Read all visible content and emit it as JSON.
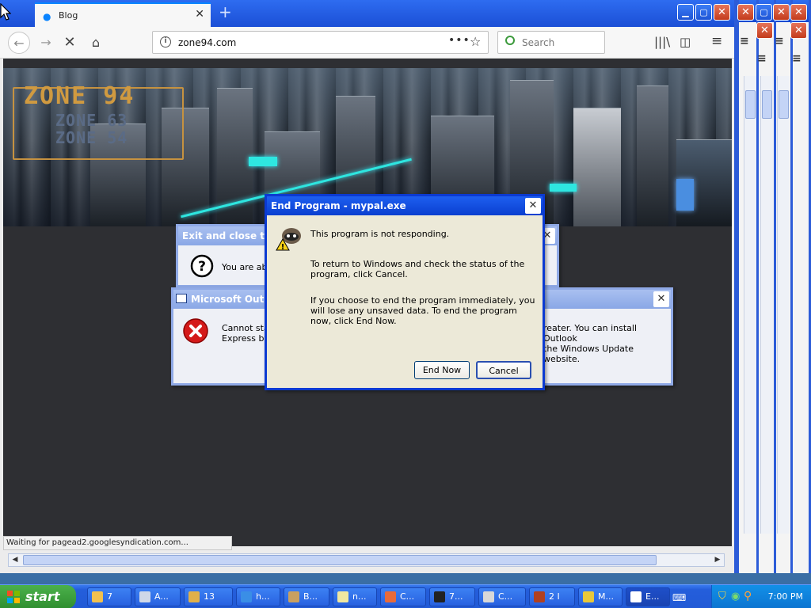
{
  "browser": {
    "tab_title": "Blog",
    "url": "zone94.com",
    "search_placeholder": "Search",
    "status_text": "Waiting for pagead2.googlesyndication.com..."
  },
  "banner": {
    "logo_main": "ZONE 94",
    "logo_sub1": "ZONE 63",
    "logo_sub2": "ZONE 54"
  },
  "dialogs": {
    "exit": {
      "title": "Exit and close tab",
      "text": "You are abo"
    },
    "outlook": {
      "title": "Microsoft Outlo",
      "text_left": "Cannot star",
      "text_left2": "Express by",
      "text_right": "reater.  You can install Outlook",
      "text_right2": "the Windows Update website."
    },
    "end_program": {
      "title": "End Program - mypal.exe",
      "line1": "This program is not responding.",
      "para2": "To return to Windows and check the status of the program, click Cancel.",
      "para3": "If you choose to end the program immediately, you will lose any unsaved data. To end the program now, click End Now.",
      "end_now": "End Now",
      "cancel": "Cancel"
    }
  },
  "taskbar": {
    "start": "start",
    "items": [
      {
        "label": "7",
        "color": "#f2c14e"
      },
      {
        "label": "A...",
        "color": "#cfd8e8"
      },
      {
        "label": "13",
        "color": "#e0b04a"
      },
      {
        "label": "h...",
        "color": "#3a8ee6"
      },
      {
        "label": "B...",
        "color": "#c9a060"
      },
      {
        "label": "n...",
        "color": "#f0e7a0"
      },
      {
        "label": "C...",
        "color": "#e86a3a"
      },
      {
        "label": "7...",
        "color": "#222222"
      },
      {
        "label": "C...",
        "color": "#d8d8d8"
      },
      {
        "label": "2 I",
        "color": "#b04020"
      },
      {
        "label": "M...",
        "color": "#e8c83a"
      },
      {
        "label": "E...",
        "color": "#ffffff"
      }
    ],
    "clock": "7:00 PM"
  },
  "colors": {
    "xp_title_blue": "#0a3fd0",
    "accent": "#0a84ff",
    "page_bg": "#2e2f33"
  }
}
